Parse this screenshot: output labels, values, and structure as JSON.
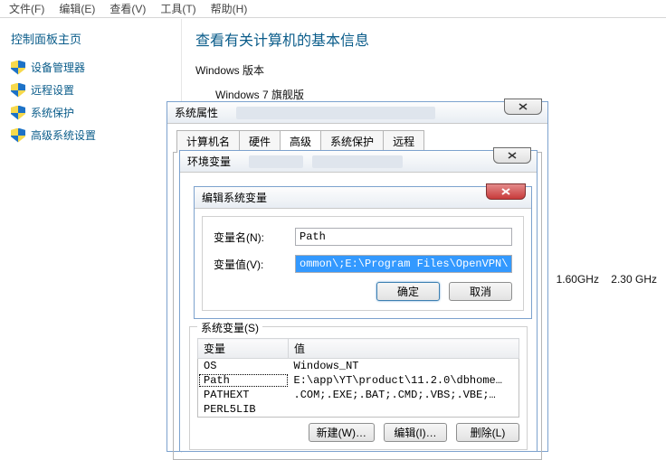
{
  "menubar": [
    "文件(F)",
    "编辑(E)",
    "查看(V)",
    "工具(T)",
    "帮助(H)"
  ],
  "sidebar": {
    "title": "控制面板主页",
    "items": [
      "设备管理器",
      "远程设置",
      "系统保护",
      "高级系统设置"
    ]
  },
  "main": {
    "title": "查看有关计算机的基本信息",
    "section": "Windows 版本",
    "edition": "Windows 7 旗舰版"
  },
  "cpu": {
    "a": "1.60GHz",
    "b": "2.30 GHz"
  },
  "sysdlg": {
    "title": "系统属性",
    "tabs": [
      "计算机名",
      "硬件",
      "高级",
      "系统保护",
      "远程"
    ]
  },
  "envdlg": {
    "title": "环境变量",
    "group_label": "系统变量(S)",
    "th_name": "变量",
    "th_value": "值",
    "rows": [
      {
        "name": "OS",
        "value": "Windows_NT"
      },
      {
        "name": "Path",
        "value": "E:\\app\\YT\\product\\11.2.0\\dbhome…"
      },
      {
        "name": "PATHEXT",
        "value": ".COM;.EXE;.BAT;.CMD;.VBS;.VBE;…"
      },
      {
        "name": "PERL5LIB",
        "value": ""
      }
    ],
    "btn_new": "新建(W)…",
    "btn_edit": "编辑(I)…",
    "btn_del": "删除(L)"
  },
  "editdlg": {
    "title": "编辑系统变量",
    "name_label": "变量名(N):",
    "value_label": "变量值(V):",
    "name_value": "Path",
    "value_value": "ommon\\;E:\\Program Files\\OpenVPN\\bin",
    "ok": "确定",
    "cancel": "取消"
  }
}
